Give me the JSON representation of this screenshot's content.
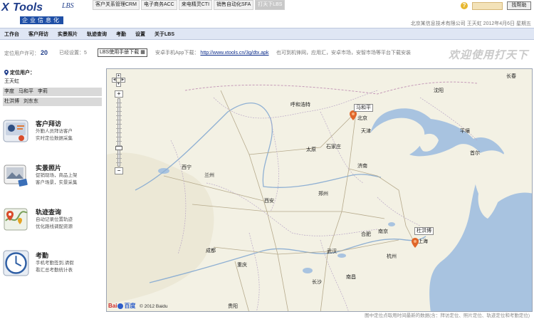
{
  "brand": {
    "x_letter": "X",
    "name": "Tools",
    "suffix": "LBS",
    "subtitle": "企业信息化"
  },
  "product_tabs": [
    {
      "label": "客户关系管理CRM",
      "active": false
    },
    {
      "label": "电子商务ACC",
      "active": false
    },
    {
      "label": "来电精灵CTI",
      "active": false
    },
    {
      "label": "销售自动化SFA",
      "active": false
    },
    {
      "label": "打天下LBS",
      "active": true
    }
  ],
  "header": {
    "help_icon": "question-circle-icon",
    "search_button": "找帮助",
    "company_line": "北京某信息技术有限公司  王天虹  2012年4月6日 星期五"
  },
  "nav": [
    "工作台",
    "客户拜访",
    "实景照片",
    "轨迹查询",
    "考勤",
    "设置",
    "关于LBS"
  ],
  "info": {
    "license_label": "定位用户许可：",
    "license_count": "20",
    "used_label": "已经设置：5",
    "manual_link": "LBS使用手册下载",
    "app_label": "安卓手机App下载：",
    "app_url": "http://www.xtools.cn/3g/dtx.apk",
    "app_hint": "也可到机锋网，应用汇，安卓市场，安智市场等平台下载安装",
    "welcome": "欢迎使用打天下"
  },
  "users": {
    "title": "定位用户：",
    "rows": [
      [
        "王天虹"
      ],
      [
        "李度",
        "马和平",
        "李莉"
      ],
      [
        "杜洪博",
        "刘东东"
      ]
    ]
  },
  "features": [
    {
      "title": "客户拜访",
      "lines": [
        "外勤人员拜访客户",
        "实时定位数据采集"
      ],
      "icon": "customer-visit-icon"
    },
    {
      "title": "实景照片",
      "lines": [
        "促销现场，商品上架",
        "客户场景，实景采集"
      ],
      "icon": "photo-icon"
    },
    {
      "title": "轨迹查询",
      "lines": [
        "自动记录位置轨迹",
        "优化路线调配资源"
      ],
      "icon": "track-map-icon"
    },
    {
      "title": "考勤",
      "lines": [
        "手机考勤签到,请假",
        "看汇总考勤统计表"
      ],
      "icon": "clock-icon"
    }
  ],
  "map": {
    "cities": [
      {
        "name": "呼和浩特"
      },
      {
        "name": "北京"
      },
      {
        "name": "天津"
      },
      {
        "name": "太原"
      },
      {
        "name": "石家庄"
      },
      {
        "name": "沈阳"
      },
      {
        "name": "长春"
      },
      {
        "name": "平壤"
      },
      {
        "name": "首尔"
      },
      {
        "name": "西宁"
      },
      {
        "name": "兰州"
      },
      {
        "name": "济南"
      },
      {
        "name": "郑州"
      },
      {
        "name": "西安"
      },
      {
        "name": "合肥"
      },
      {
        "name": "南京"
      },
      {
        "name": "上海"
      },
      {
        "name": "杭州"
      },
      {
        "name": "武汉"
      },
      {
        "name": "成都"
      },
      {
        "name": "重庆"
      },
      {
        "name": "长沙"
      },
      {
        "name": "南昌"
      },
      {
        "name": "贵阳"
      }
    ],
    "markers": [
      "马和平",
      "杜洪博"
    ],
    "zoom_plus": "+",
    "zoom_minus": "−",
    "baidu_logo": "Bai",
    "baidu_logo_2": "百度",
    "copyright": "© 2012 Baidu"
  },
  "footnote": "图中定位点取用时间最新的数据(含：拜访定位、照片定位、轨迹定位和考勤定位)",
  "colors": {
    "nav_bg": "#dfe6f4",
    "brand_blue": "#1f3d8a",
    "marker": "#e0662a"
  }
}
